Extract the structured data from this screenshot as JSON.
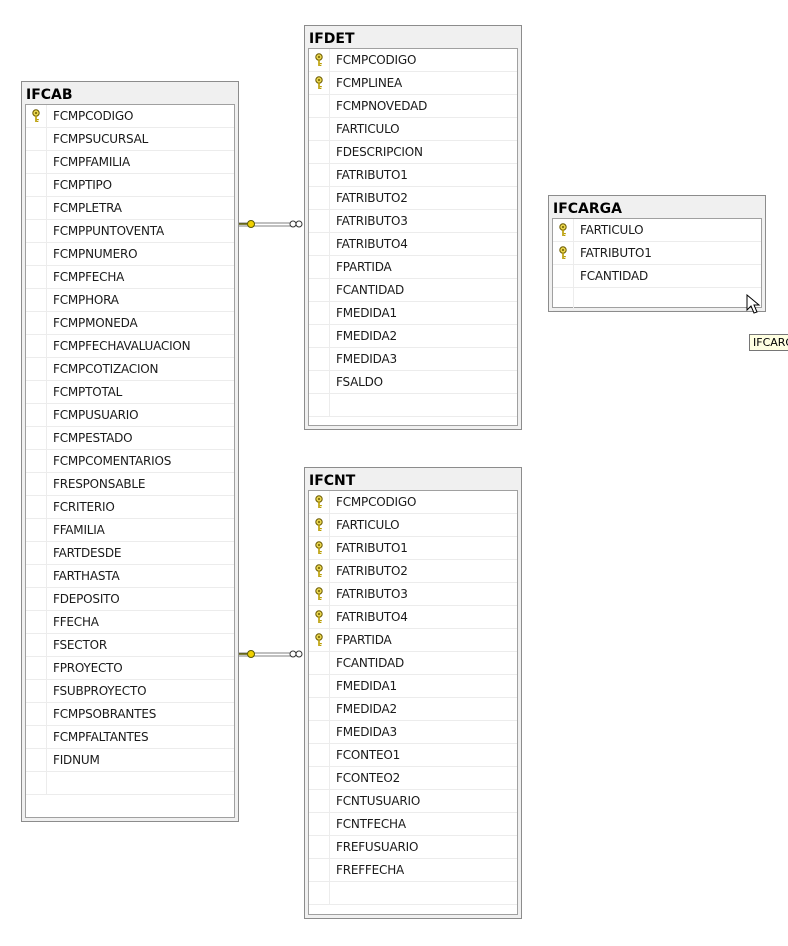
{
  "tables": {
    "ifcab": {
      "name": "IFCAB",
      "columns": [
        {
          "name": "FCMPCODIGO",
          "key": true
        },
        {
          "name": "FCMPSUCURSAL",
          "key": false
        },
        {
          "name": "FCMPFAMILIA",
          "key": false
        },
        {
          "name": "FCMPTIPO",
          "key": false
        },
        {
          "name": "FCMPLETRA",
          "key": false
        },
        {
          "name": "FCMPPUNTOVENTA",
          "key": false
        },
        {
          "name": "FCMPNUMERO",
          "key": false
        },
        {
          "name": "FCMPFECHA",
          "key": false
        },
        {
          "name": "FCMPHORA",
          "key": false
        },
        {
          "name": "FCMPMONEDA",
          "key": false
        },
        {
          "name": "FCMPFECHAVALUACION",
          "key": false
        },
        {
          "name": "FCMPCOTIZACION",
          "key": false
        },
        {
          "name": "FCMPTOTAL",
          "key": false
        },
        {
          "name": "FCMPUSUARIO",
          "key": false
        },
        {
          "name": "FCMPESTADO",
          "key": false
        },
        {
          "name": "FCMPCOMENTARIOS",
          "key": false
        },
        {
          "name": "FRESPONSABLE",
          "key": false
        },
        {
          "name": "FCRITERIO",
          "key": false
        },
        {
          "name": "FFAMILIA",
          "key": false
        },
        {
          "name": "FARTDESDE",
          "key": false
        },
        {
          "name": "FARTHASTA",
          "key": false
        },
        {
          "name": "FDEPOSITO",
          "key": false
        },
        {
          "name": "FFECHA",
          "key": false
        },
        {
          "name": "FSECTOR",
          "key": false
        },
        {
          "name": "FPROYECTO",
          "key": false
        },
        {
          "name": "FSUBPROYECTO",
          "key": false
        },
        {
          "name": "FCMPSOBRANTES",
          "key": false
        },
        {
          "name": "FCMPFALTANTES",
          "key": false
        },
        {
          "name": "FIDNUM",
          "key": false
        }
      ]
    },
    "ifdet": {
      "name": "IFDET",
      "columns": [
        {
          "name": "FCMPCODIGO",
          "key": true
        },
        {
          "name": "FCMPLINEA",
          "key": true
        },
        {
          "name": "FCMPNOVEDAD",
          "key": false
        },
        {
          "name": "FARTICULO",
          "key": false
        },
        {
          "name": "FDESCRIPCION",
          "key": false
        },
        {
          "name": "FATRIBUTO1",
          "key": false
        },
        {
          "name": "FATRIBUTO2",
          "key": false
        },
        {
          "name": "FATRIBUTO3",
          "key": false
        },
        {
          "name": "FATRIBUTO4",
          "key": false
        },
        {
          "name": "FPARTIDA",
          "key": false
        },
        {
          "name": "FCANTIDAD",
          "key": false
        },
        {
          "name": "FMEDIDA1",
          "key": false
        },
        {
          "name": "FMEDIDA2",
          "key": false
        },
        {
          "name": "FMEDIDA3",
          "key": false
        },
        {
          "name": "FSALDO",
          "key": false
        }
      ]
    },
    "ifcarga": {
      "name": "IFCARGA",
      "columns": [
        {
          "name": "FARTICULO",
          "key": true
        },
        {
          "name": "FATRIBUTO1",
          "key": true
        },
        {
          "name": "FCANTIDAD",
          "key": false
        }
      ]
    },
    "ifcnt": {
      "name": "IFCNT",
      "columns": [
        {
          "name": "FCMPCODIGO",
          "key": true
        },
        {
          "name": "FARTICULO",
          "key": true
        },
        {
          "name": "FATRIBUTO1",
          "key": true
        },
        {
          "name": "FATRIBUTO2",
          "key": true
        },
        {
          "name": "FATRIBUTO3",
          "key": true
        },
        {
          "name": "FATRIBUTO4",
          "key": true
        },
        {
          "name": "FPARTIDA",
          "key": true
        },
        {
          "name": "FCANTIDAD",
          "key": false
        },
        {
          "name": "FMEDIDA1",
          "key": false
        },
        {
          "name": "FMEDIDA2",
          "key": false
        },
        {
          "name": "FMEDIDA3",
          "key": false
        },
        {
          "name": "FCONTEO1",
          "key": false
        },
        {
          "name": "FCONTEO2",
          "key": false
        },
        {
          "name": "FCNTUSUARIO",
          "key": false
        },
        {
          "name": "FCNTFECHA",
          "key": false
        },
        {
          "name": "FREFUSUARIO",
          "key": false
        },
        {
          "name": "FREFFECHA",
          "key": false
        }
      ]
    }
  },
  "relationships": [
    {
      "from": "IFCAB",
      "to": "IFDET",
      "type": "one-to-many"
    },
    {
      "from": "IFCAB",
      "to": "IFCNT",
      "type": "one-to-many"
    }
  ],
  "tooltip": {
    "text": "IFCARGA"
  },
  "colors": {
    "key_icon": "#e8d44d",
    "connector": "#808080",
    "table_header": "#f0f0f0"
  }
}
